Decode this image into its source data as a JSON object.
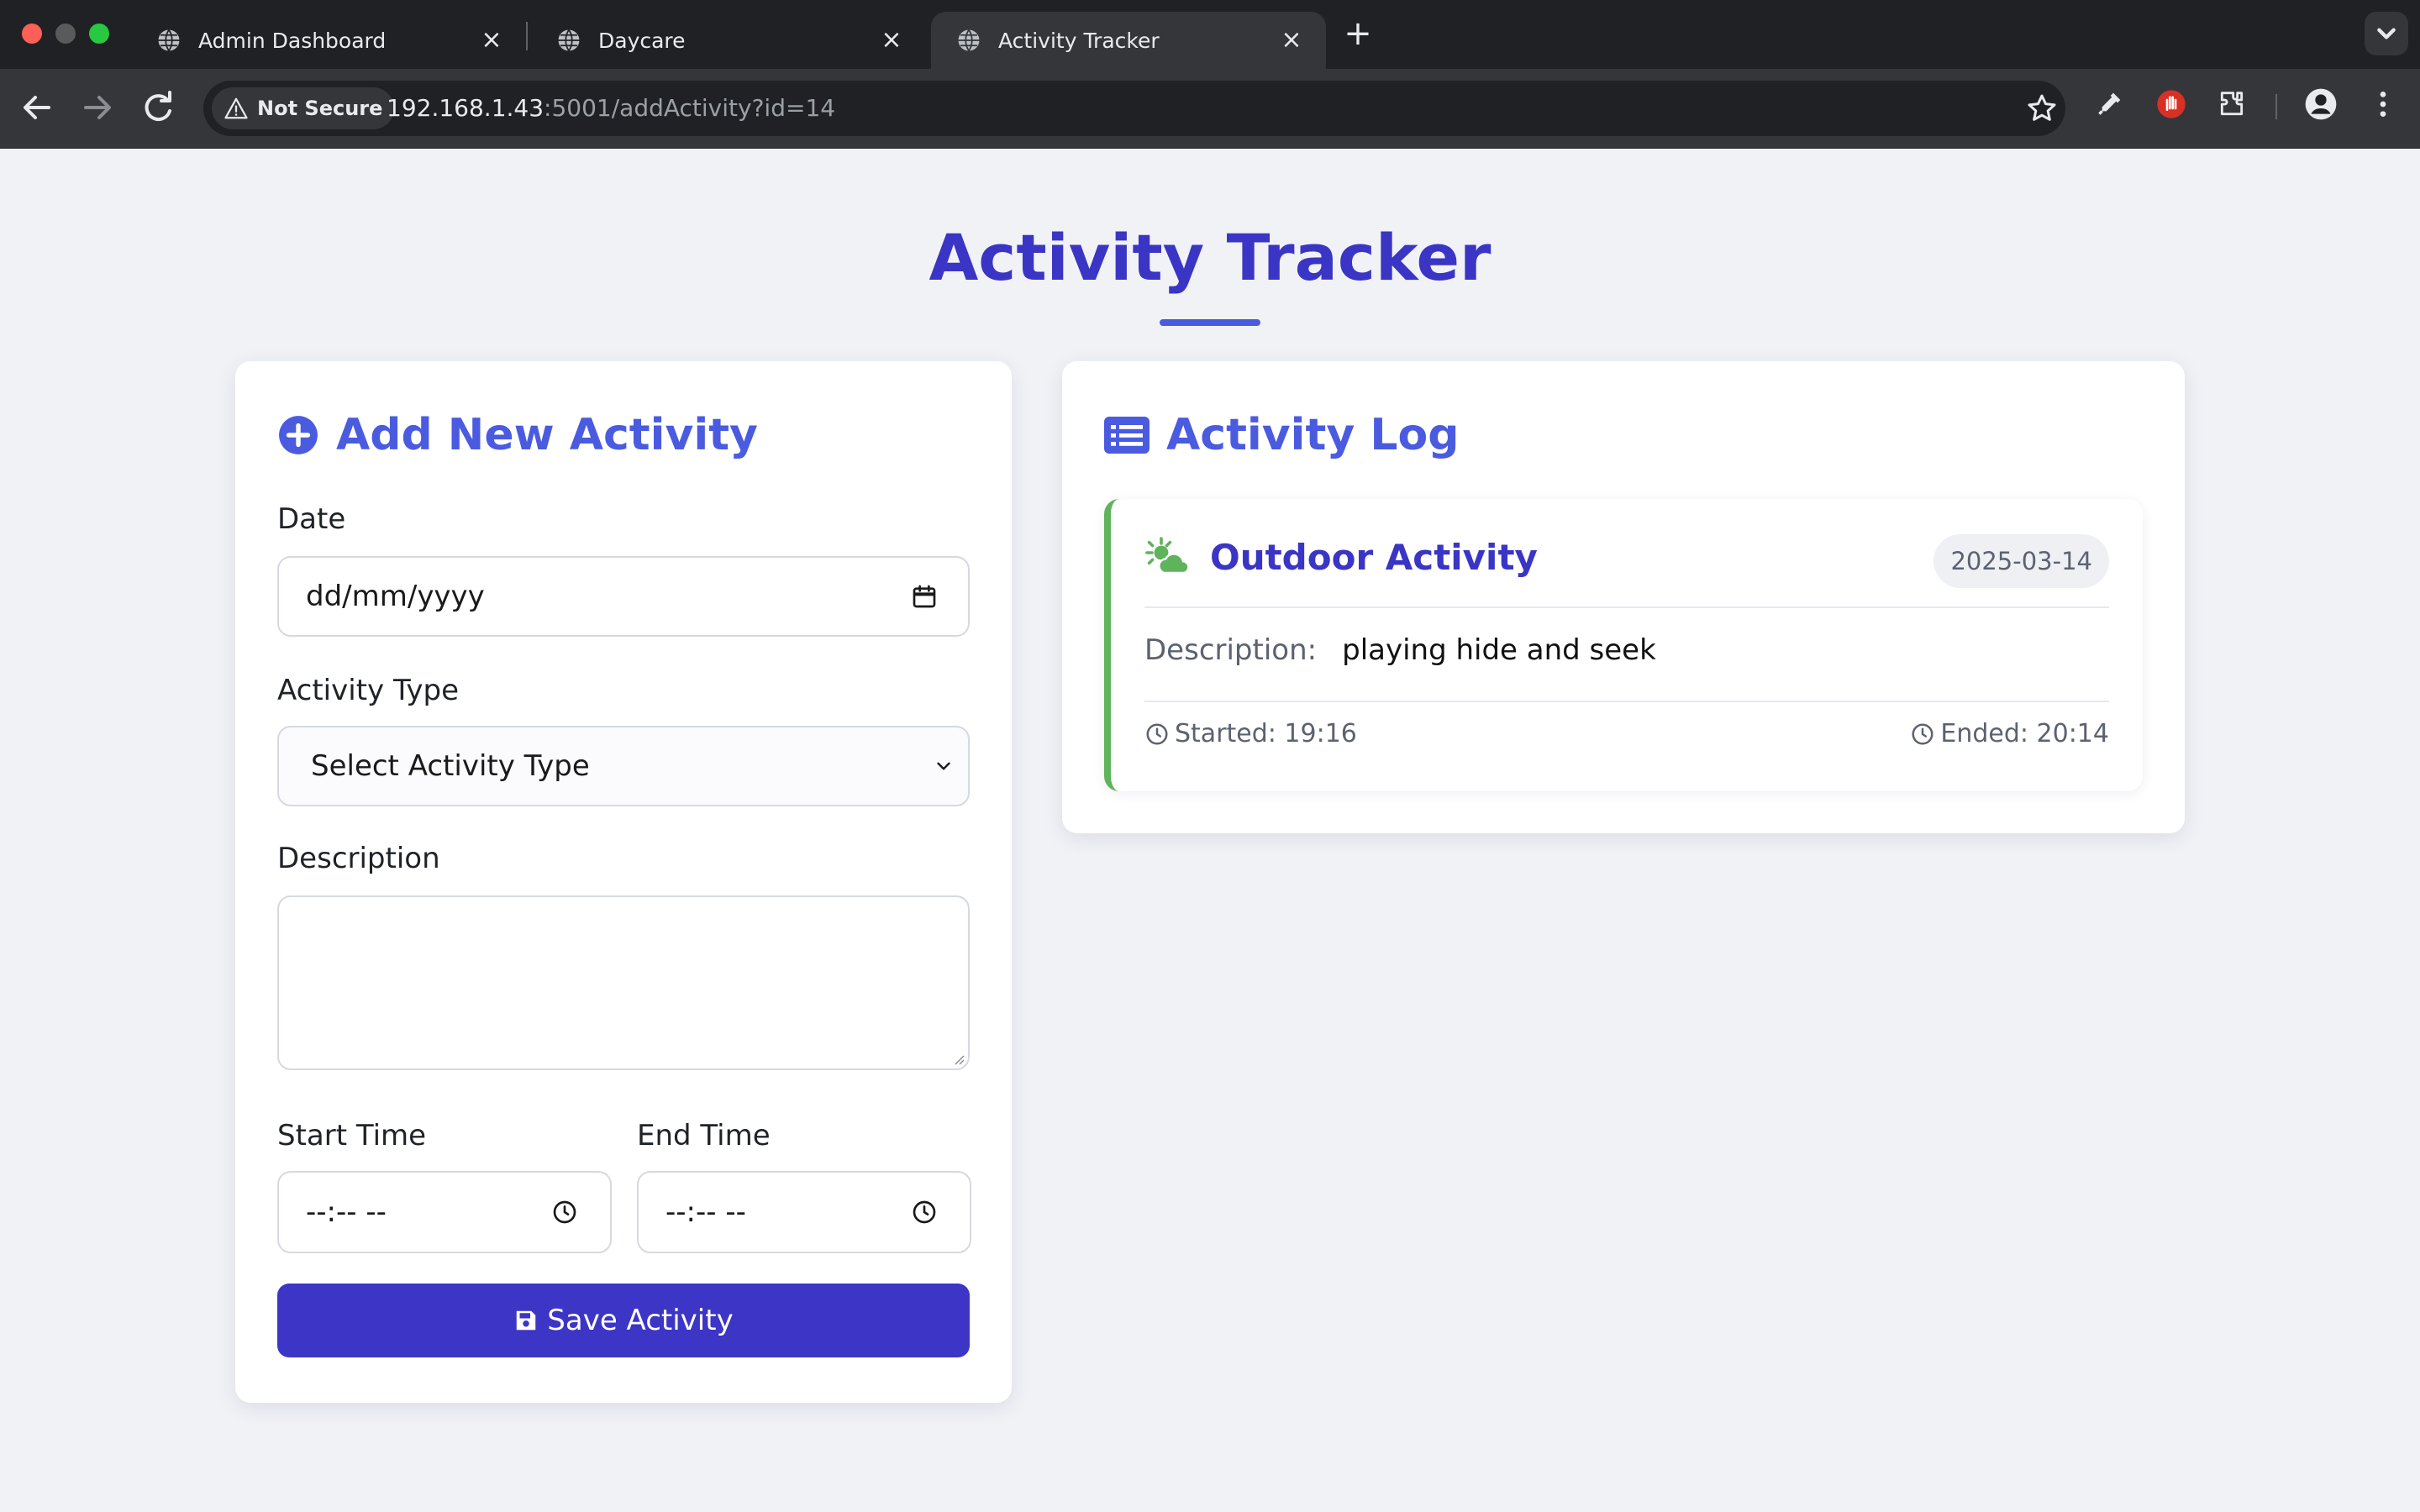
{
  "browser": {
    "tabs": [
      {
        "title": "Admin Dashboard",
        "active": false
      },
      {
        "title": "Daycare",
        "active": false
      },
      {
        "title": "Activity Tracker",
        "active": true
      }
    ],
    "security_label": "Not Secure",
    "url_host": "192.168.1.43",
    "url_rest": ":5001/addActivity?id=14"
  },
  "page": {
    "title": "Activity Tracker"
  },
  "form": {
    "heading": "Add New Activity",
    "date_label": "Date",
    "date_placeholder": "dd/mm/yyyy",
    "type_label": "Activity Type",
    "type_selected": "Select Activity Type",
    "description_label": "Description",
    "description_value": "",
    "start_label": "Start Time",
    "start_placeholder": "--:-- --",
    "end_label": "End Time",
    "end_placeholder": "--:-- --",
    "save_label": "Save Activity"
  },
  "log": {
    "heading": "Activity Log",
    "entries": [
      {
        "type": "Outdoor Activity",
        "date": "2025-03-14",
        "description_label": "Description:",
        "description": "playing hide and seek",
        "started": "Started: 19:16",
        "ended": "Ended: 20:14"
      }
    ]
  },
  "colors": {
    "primary": "#3c35c6",
    "heading_blue": "#4a5be0",
    "outdoor_green": "#5fb35a"
  }
}
